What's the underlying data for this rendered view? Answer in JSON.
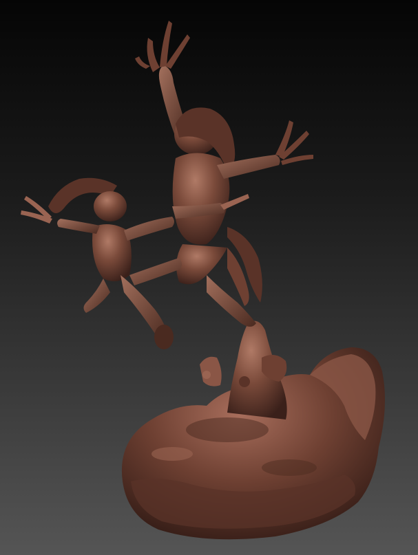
{
  "scene": {
    "subject": "sculpt-render",
    "background_top": "#050505",
    "background_bottom": "#555555",
    "material_color": "#7a4a3a",
    "material_highlight": "#b07a66",
    "material_shadow": "#3a201a"
  }
}
